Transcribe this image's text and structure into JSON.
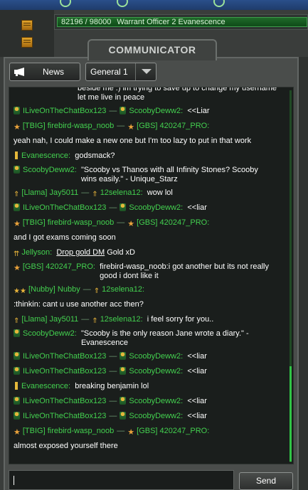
{
  "rank": {
    "xp": "82196 / 98000",
    "title": "Warrant Officer 2 Evanescence"
  },
  "header": {
    "title": "COMMUNICATOR"
  },
  "news_button": {
    "label": "News",
    "icon": "megaphone-icon"
  },
  "channel_select": {
    "value": "General 1"
  },
  "send_button": {
    "label": "Send"
  },
  "input": {
    "value": ""
  },
  "colors": {
    "username": "#43d04f",
    "panel": "#4a4d4b",
    "chat_bg": "#1a1e1c",
    "scroll": "#31c446"
  },
  "messages": [
    {
      "type": "text",
      "text": "beside me :) im trying to save up to change my username let me live in peace"
    },
    {
      "from": "ILiveOnTheChatBox123",
      "to": "ScoobyDeww2:",
      "text": "<<Liar"
    },
    {
      "from": "[TBIG] firebird-wasp_noob",
      "to": "[GBS] 420247_PRO:",
      "text": ""
    },
    {
      "type": "text",
      "text": "yeah nah, I could make a new one but I'm too lazy to put in that work"
    },
    {
      "from": "Evanescence:",
      "text": "godsmack?"
    },
    {
      "from": "ScoobyDeww2:",
      "text": "\"Scooby vs Thanos with all Infinity Stones? Scooby wins easily.\" - Unique_Starz"
    },
    {
      "from": "[Llama] Jay5011",
      "to": "12selena12:",
      "text": "wow lol"
    },
    {
      "from": "ILiveOnTheChatBox123",
      "to": "ScoobyDeww2:",
      "text": "<<liar"
    },
    {
      "from": "[TBIG] firebird-wasp_noob",
      "to": "[GBS] 420247_PRO:",
      "text": ""
    },
    {
      "type": "text",
      "text": "and I got exams coming soon"
    },
    {
      "from": "Jellyson:",
      "link": "Drop gold DM",
      "text": "Gold xD"
    },
    {
      "from": "[GBS] 420247_PRO:",
      "text": "firebird-wasp_noob:i got another but its not really good i dont like it"
    },
    {
      "from": "[Nubby] Nubby",
      "to": "12selena12:",
      "text": ""
    },
    {
      "type": "text",
      "text": ":thinkin: cant u use another acc then?"
    },
    {
      "from": "[Llama] Jay5011",
      "to": "12selena12:",
      "text": "i feel sorry for you.."
    },
    {
      "from": "ScoobyDeww2:",
      "text": "\"Scooby is the only reason Jane wrote a diary.\" - Evanescence"
    },
    {
      "from": "ILiveOnTheChatBox123",
      "to": "ScoobyDeww2:",
      "text": "<<liar"
    },
    {
      "from": "ILiveOnTheChatBox123",
      "to": "ScoobyDeww2:",
      "text": "<<liar"
    },
    {
      "from": "Evanescence:",
      "text": "breaking benjamin lol"
    },
    {
      "from": "ILiveOnTheChatBox123",
      "to": "ScoobyDeww2:",
      "text": "<<liar"
    },
    {
      "from": "ILiveOnTheChatBox123",
      "to": "ScoobyDeww2:",
      "text": "<<liar"
    },
    {
      "from": "[TBIG] firebird-wasp_noob",
      "to": "[GBS] 420247_PRO:",
      "text": ""
    },
    {
      "type": "text",
      "text": "almost exposed yourself there"
    }
  ]
}
